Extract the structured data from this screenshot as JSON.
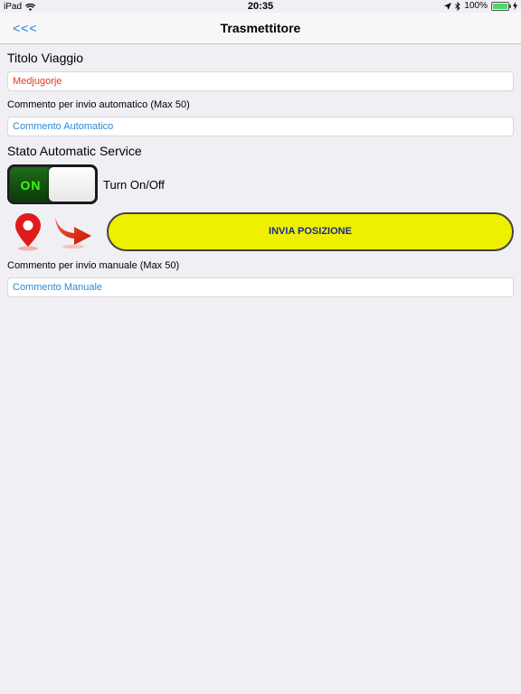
{
  "status_bar": {
    "device": "iPad",
    "time": "20:35",
    "battery": "100%"
  },
  "nav": {
    "back_label": "<<<",
    "title": "Trasmettitore"
  },
  "form": {
    "trip_title_label": "Titolo Viaggio",
    "trip_title_value": "Medjugorje",
    "auto_comment_label": "Commento per invio automatico (Max 50)",
    "auto_comment_placeholder": "Commento Automatico",
    "service_state_label": "Stato Automatic Service",
    "toggle_state_text": "ON",
    "toggle_label": "Turn On/Off",
    "send_button_label": "INVIA POSIZIONE",
    "manual_comment_label": "Commento per invio manuale (Max 50)",
    "manual_comment_placeholder": "Commento Manuale"
  },
  "colors": {
    "accent_blue": "#1a7de0",
    "button_yellow": "#eef000",
    "toggle_green": "#39ff14",
    "pin_red": "#e01b1b"
  },
  "icons": {
    "pin": "map-pin-icon",
    "arrow": "red-arrow-icon",
    "wifi": "wifi-icon",
    "location": "location-arrow-icon",
    "bluetooth": "bluetooth-icon",
    "battery": "battery-icon"
  }
}
